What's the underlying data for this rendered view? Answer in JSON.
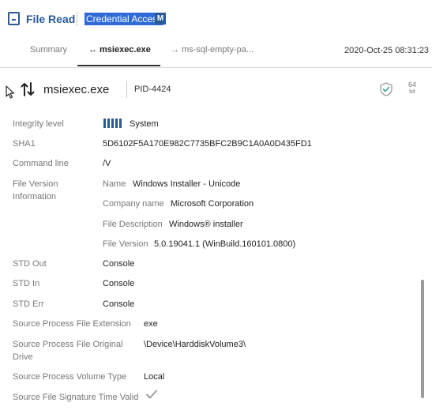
{
  "header": {
    "title": "File Read",
    "subtitle": "Credential Access",
    "badge": "M"
  },
  "tabs": [
    {
      "label": "Summary",
      "active": false
    },
    {
      "label": "msiexec.exe",
      "active": true
    },
    {
      "label": "ms-sql-empty-pa...",
      "active": false
    }
  ],
  "timestamp": "2020-Oct-25 08:31:23",
  "process": {
    "name": "msiexec.exe",
    "pid": "PID-4424",
    "arch_num": "64",
    "arch_unit": "bit"
  },
  "details": {
    "integrity_label": "Integrity level",
    "integrity_value": "System",
    "sha1_label": "SHA1",
    "sha1_value": "5D6102F5A170E982C7735BFC2B9C1A0A0D435FD1",
    "cmd_label": "Command line",
    "cmd_value": "/V",
    "fvi_label_1": "File Version",
    "fvi_label_2": "Information",
    "fvi": {
      "name_label": "Name",
      "name_value": "Windows Installer - Unicode",
      "company_label": "Company name",
      "company_value": "Microsoft Corporation",
      "desc_label": "File Description",
      "desc_value": "Windows® installer",
      "ver_label": "File Version",
      "ver_value": "5.0.19041.1 (WinBuild.160101.0800)"
    },
    "stdout_label": "STD Out",
    "stdout_value": "Console",
    "stdin_label": "STD In",
    "stdin_value": "Console",
    "stderr_label": "STD Err",
    "stderr_value": "Console",
    "ext_label": "Source Process File Extension",
    "ext_value": "exe",
    "drive_label_1": "Source Process File Original",
    "drive_label_2": "Drive",
    "drive_value": "\\Device\\HarddiskVolume3\\",
    "voltype_label": "Source Process Volume Type",
    "voltype_value": "Local",
    "sigtime_label": "Source File Signature Time Valid"
  },
  "colors": {
    "accent": "#2a5a96",
    "highlight": "#2f6bd6"
  }
}
